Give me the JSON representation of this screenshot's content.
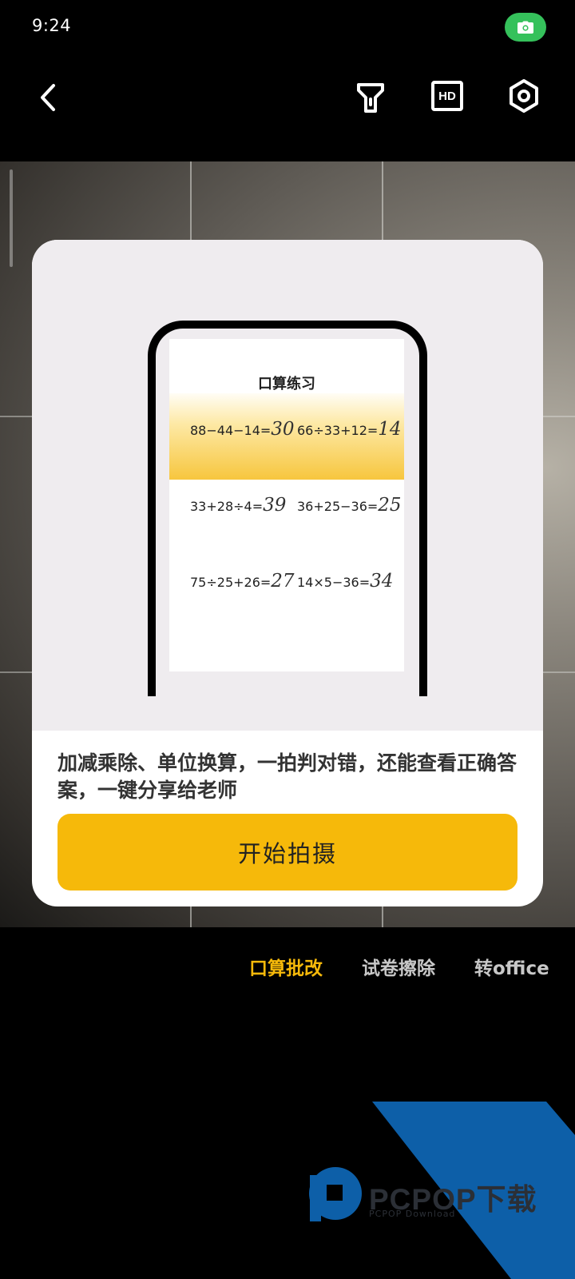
{
  "status_bar": {
    "time": "9:24"
  },
  "toolbar": {
    "back_icon": "chevron-left-icon",
    "flashlight_icon": "flashlight-icon",
    "hd_label": "HD",
    "settings_icon": "hexagon-gear-icon"
  },
  "card": {
    "preview": {
      "title": "口算练习",
      "equations": [
        {
          "expr": "88−44−14=",
          "answer": "30"
        },
        {
          "expr": "66÷33+12=",
          "answer": "14"
        },
        {
          "expr": "33+28÷4=",
          "answer": "39"
        },
        {
          "expr": "36+25−36=",
          "answer": "25"
        },
        {
          "expr": "75÷25+26=",
          "answer": "27"
        },
        {
          "expr": "14×5−36=",
          "answer": "34"
        }
      ]
    },
    "description": "加减乘除、单位换算，一拍判对错，还能查看正确答案，一键分享给老师",
    "start_button": "开始拍摄"
  },
  "mode_tabs": [
    {
      "label": "口算批改",
      "active": true
    },
    {
      "label": "试卷擦除",
      "active": false
    },
    {
      "label": "转office",
      "active": false
    }
  ],
  "colors": {
    "accent": "#f6b90a",
    "active_tab": "#f6b90a",
    "inactive_tab": "#c8c8c8",
    "camera_pill": "#35c15b",
    "watermark_blue": "#0d5fa8"
  },
  "watermark": {
    "brand": "PCPOP下载",
    "sub": "PCPOP Download"
  }
}
